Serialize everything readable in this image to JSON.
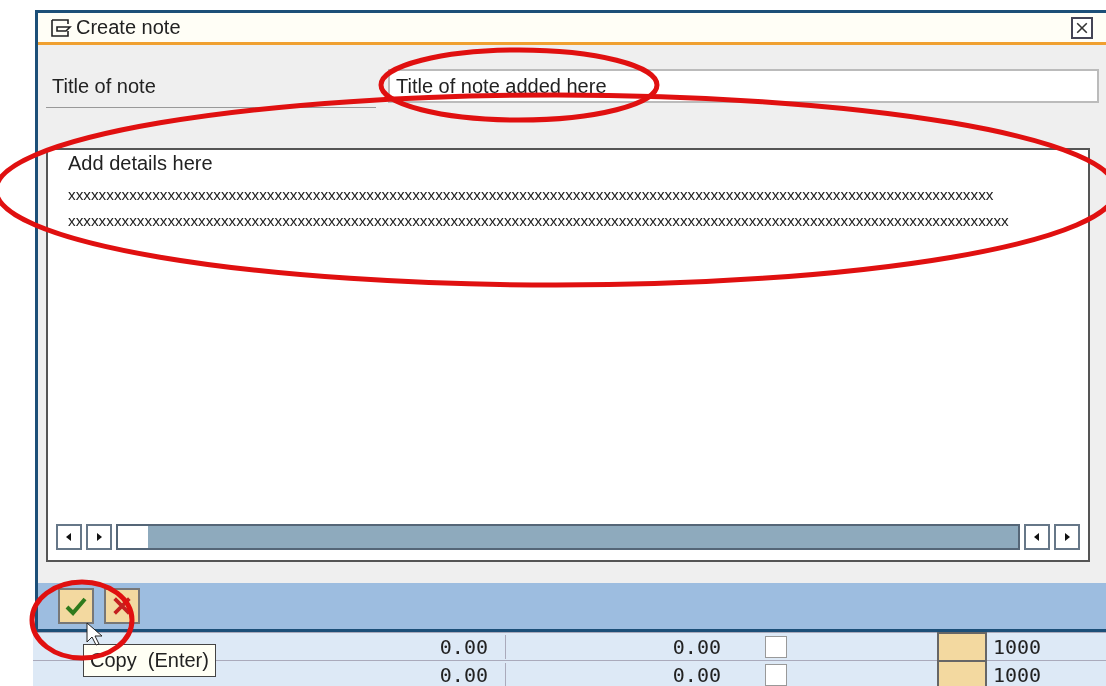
{
  "dialog": {
    "title": "Create note",
    "fields": [
      {
        "label": "Title of note",
        "value": "Title of note added here"
      }
    ],
    "editor": {
      "lines": [
        "Add details here",
        "xxxxxxxxxxxxxxxxxxxxxxxxxxxxxxxxxxxxxxxxxxxxxxxxxxxxxxxxxxxxxxxxxxxxxxxxxxxxxxxxxxxxxxxxxxxxxxxxxxxxxxxxxxxxxxxxxxxxxxxxx",
        "xxxxxxxxxxxxxxxxxxxxxxxxxxxxxxxxxxxxxxxxxxxxxxxxxxxxxxxxxxxxxxxxxxxxxxxxxxxxxxxxxxxxxxxxxxxxxxxxxxxxxxxxxxxxxxxxxxxxxxxxxxx"
      ]
    },
    "buttons": [
      {
        "kind": "confirm"
      },
      {
        "kind": "cancel"
      }
    ],
    "tooltip": "Copy  (Enter)"
  },
  "background_table": {
    "rows": [
      {
        "cells": [
          "0.00",
          "0.00",
          "1000"
        ],
        "checked": false
      },
      {
        "cells": [
          "0.00",
          "0.00",
          "1000"
        ],
        "checked": false
      }
    ]
  }
}
